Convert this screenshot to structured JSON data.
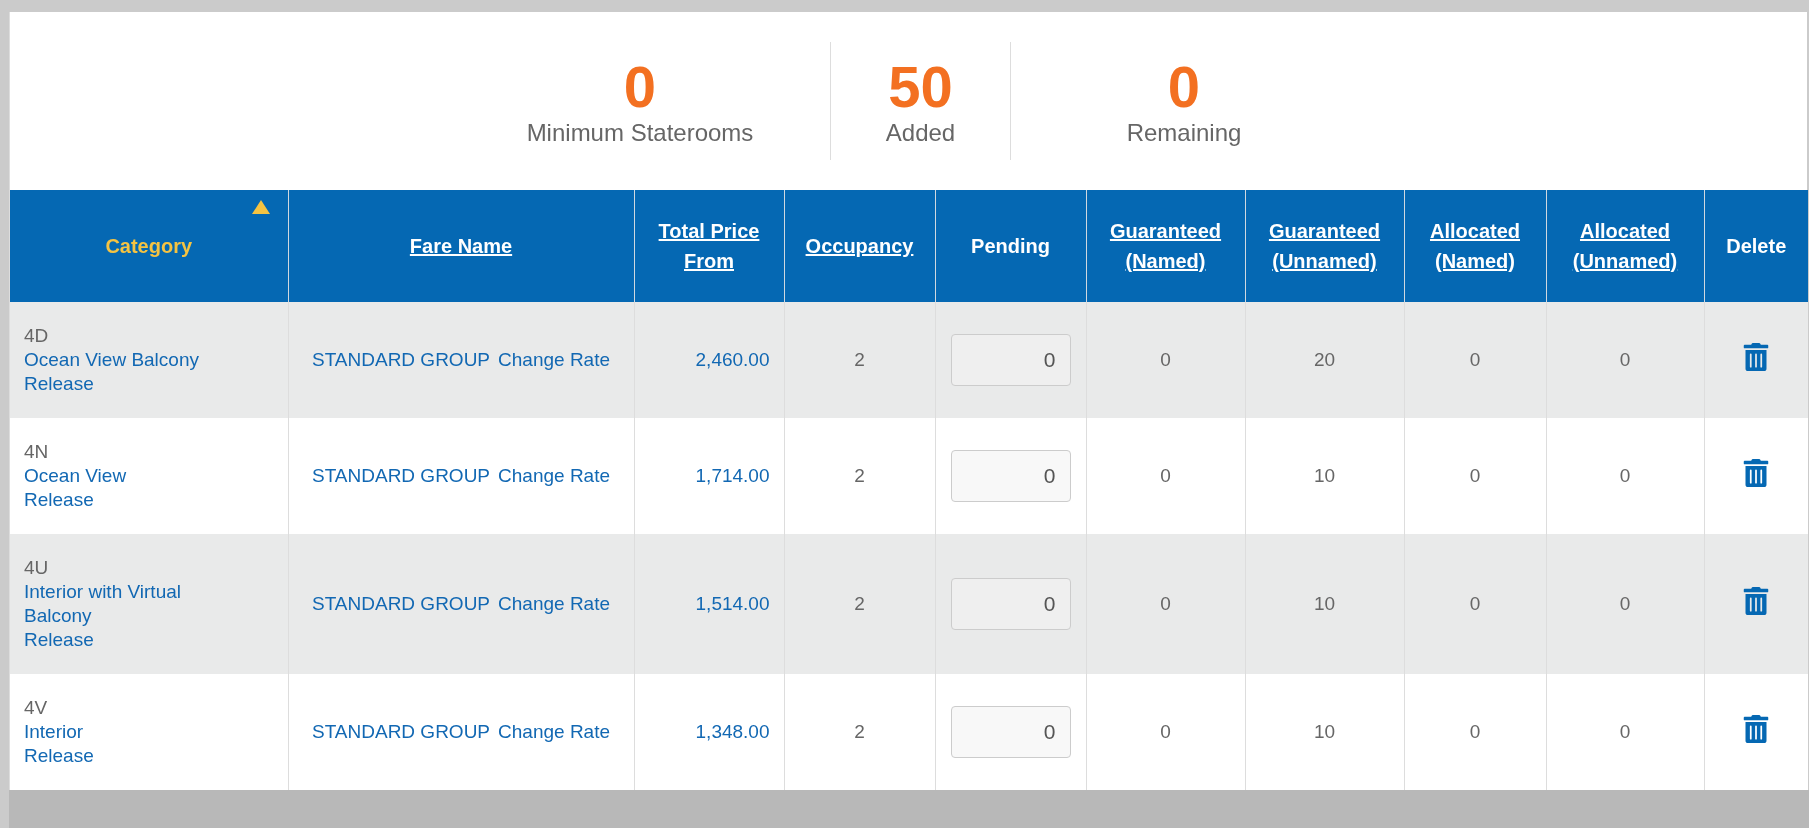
{
  "summary": [
    {
      "value": "0",
      "label": "Minimum Staterooms"
    },
    {
      "value": "50",
      "label": "Added"
    },
    {
      "value": "0",
      "label": "Remaining"
    }
  ],
  "table": {
    "columns": [
      {
        "label": "Category",
        "link": false,
        "sorted": true
      },
      {
        "label": "Fare Name",
        "link": true,
        "sorted": false
      },
      {
        "label": "Total Price From",
        "link": true,
        "sorted": false
      },
      {
        "label": "Occupancy",
        "link": true,
        "sorted": false
      },
      {
        "label": "Pending",
        "link": false,
        "sorted": false
      },
      {
        "label": "Guaranteed (Named)",
        "link": true,
        "sorted": false
      },
      {
        "label": "Guaranteed (Unnamed)",
        "link": true,
        "sorted": false
      },
      {
        "label": "Allocated (Named)",
        "link": true,
        "sorted": false
      },
      {
        "label": "Allocated (Unnamed)",
        "link": true,
        "sorted": false
      },
      {
        "label": "Delete",
        "link": false,
        "sorted": false
      }
    ],
    "rows": [
      {
        "code": "4D",
        "category": "Ocean View Balcony",
        "release": "Release",
        "fare": "STANDARD GROUP",
        "change": "Change Rate",
        "price": "2,460.00",
        "occupancy": "2",
        "pending": "0",
        "guaranteed_named": "0",
        "guaranteed_unnamed": "20",
        "allocated_named": "0",
        "allocated_unnamed": "0"
      },
      {
        "code": "4N",
        "category": "Ocean View",
        "release": "Release",
        "fare": "STANDARD GROUP",
        "change": "Change Rate",
        "price": "1,714.00",
        "occupancy": "2",
        "pending": "0",
        "guaranteed_named": "0",
        "guaranteed_unnamed": "10",
        "allocated_named": "0",
        "allocated_unnamed": "0"
      },
      {
        "code": "4U",
        "category": "Interior with Virtual Balcony",
        "release": "Release",
        "fare": "STANDARD GROUP",
        "change": "Change Rate",
        "price": "1,514.00",
        "occupancy": "2",
        "pending": "0",
        "guaranteed_named": "0",
        "guaranteed_unnamed": "10",
        "allocated_named": "0",
        "allocated_unnamed": "0"
      },
      {
        "code": "4V",
        "category": "Interior",
        "release": "Release",
        "fare": "STANDARD GROUP",
        "change": "Change Rate",
        "price": "1,348.00",
        "occupancy": "2",
        "pending": "0",
        "guaranteed_named": "0",
        "guaranteed_unnamed": "10",
        "allocated_named": "0",
        "allocated_unnamed": "0"
      }
    ]
  }
}
